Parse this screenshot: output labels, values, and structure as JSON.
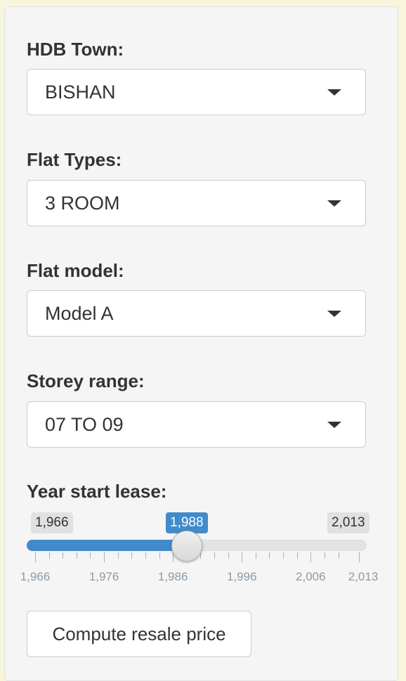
{
  "form": {
    "town": {
      "label": "HDB Town:",
      "value": "BISHAN"
    },
    "flat_type": {
      "label": "Flat Types:",
      "value": "3 ROOM"
    },
    "flat_model": {
      "label": "Flat model:",
      "value": "Model A"
    },
    "storey_range": {
      "label": "Storey range:",
      "value": "07 TO 09"
    },
    "lease_year": {
      "label": "Year start lease:",
      "min": 1966,
      "max": 2013,
      "value": 1988,
      "min_label": "1,966",
      "max_label": "2,013",
      "value_label": "1,988",
      "tick_labels": [
        "1,966",
        "1,976",
        "1,986",
        "1,996",
        "2,006",
        "2,013"
      ],
      "tick_values": [
        1966,
        1976,
        1986,
        1996,
        2006,
        2013
      ]
    },
    "submit_label": "Compute resale price"
  },
  "colors": {
    "accent": "#428bca",
    "panel_bg": "#f5f5f5",
    "page_bg": "#f7f5dc"
  },
  "icons": {
    "dropdown": "caret-down-icon"
  }
}
